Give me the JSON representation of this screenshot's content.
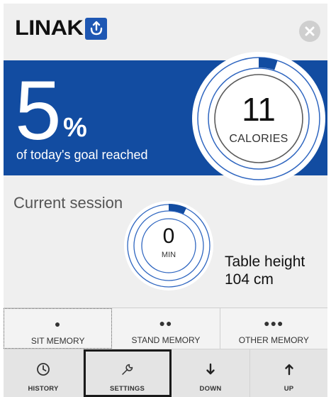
{
  "header": {
    "brand": "LINAK",
    "logo_icon": "linak-desk-icon",
    "close_icon": "close-icon"
  },
  "goal": {
    "percent": "5",
    "percent_sign": "%",
    "caption": "of today's goal reached",
    "progress_fraction": 0.05
  },
  "calories": {
    "value": "11",
    "label": "CALORIES"
  },
  "session": {
    "title": "Current session",
    "minutes_value": "0",
    "minutes_label": "MIN",
    "table_height_label": "Table height",
    "table_height_value": "104 cm"
  },
  "memory": [
    {
      "dots": "●",
      "label": "SIT MEMORY"
    },
    {
      "dots": "●●",
      "label": "STAND MEMORY"
    },
    {
      "dots": "●●●",
      "label": "OTHER MEMORY"
    }
  ],
  "nav": [
    {
      "icon": "clock-icon",
      "label": "HISTORY"
    },
    {
      "icon": "wrench-icon",
      "label": "SETTINGS"
    },
    {
      "icon": "arrow-down-icon",
      "label": "DOWN"
    },
    {
      "icon": "arrow-up-icon",
      "label": "UP"
    }
  ],
  "colors": {
    "accent": "#124ca1",
    "ring": "#1e57b3",
    "background": "#efefef"
  }
}
